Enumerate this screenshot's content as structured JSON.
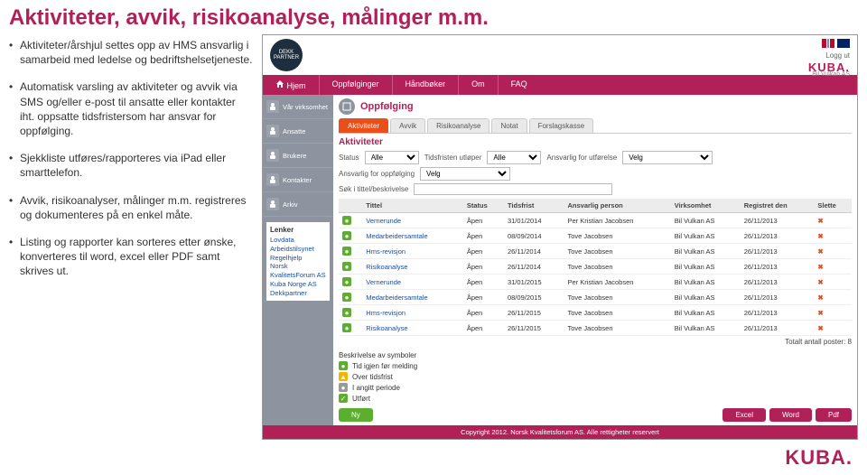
{
  "slide": {
    "title": "Aktiviteter, avvik, risikoanalyse, målinger m.m.",
    "bullets": [
      "Aktiviteter/årshjul settes opp av HMS ansvarlig i samarbeid med ledelse og bedriftshelsetjeneste.",
      "Automatisk varsling av aktiviteter og avvik via SMS og/eller e-post til ansatte eller kontakter iht. oppsatte tidsfristersom har ansvar for oppfølging.",
      "Sjekkliste utføres/rapporteres via iPad eller smarttelefon.",
      "Avvik, risikoanalyser, målinger m.m. registreres og dokumenteres på en enkel måte.",
      "Listing og rapporter kan sorteres etter ønske, konverteres til word, excel eller PDF samt skrives ut."
    ],
    "brand": "KUBA."
  },
  "app": {
    "header": {
      "badge": "DEKK PARTNER",
      "logout": "Logg ut",
      "brand": "KUBA.",
      "systemet": "systemet i skyen",
      "company": "Bil Vulkan AS"
    },
    "menu": [
      "Hjem",
      "Oppfølginger",
      "Håndbøker",
      "Om",
      "FAQ"
    ],
    "sidebar": {
      "items": [
        {
          "label": "Vår virksomhet"
        },
        {
          "label": "Ansatte"
        },
        {
          "label": "Brukere"
        },
        {
          "label": "Kontakter"
        },
        {
          "label": "Arkiv"
        }
      ],
      "links_title": "Lenker",
      "links": [
        "Lovdata",
        "Arbeidstilsynet",
        "Regelhjelp",
        "Norsk KvalitetsForum AS",
        "Kuba Norge AS",
        "Dekkpartner"
      ]
    },
    "crumb": "Oppfølging",
    "tabs": [
      {
        "label": "Aktiviteter",
        "active": true
      },
      {
        "label": "Avvik"
      },
      {
        "label": "Risikoanalyse"
      },
      {
        "label": "Notat"
      },
      {
        "label": "Forslagskasse"
      }
    ],
    "section_title": "Aktiviteter",
    "filters": {
      "status_label": "Status",
      "status_value": "Alle",
      "tidsfrist_label": "Tidsfristen utløper",
      "tidsfrist_value": "Alle",
      "ansvarlig_ut_label": "Ansvarlig for utførelse",
      "ansvarlig_ut_value": "Velg",
      "ansvarlig_opp_label": "Ansvarlig for oppfølging",
      "ansvarlig_opp_value": "Velg",
      "search_label": "Søk i tittel/beskrivelse",
      "search_placeholder": ""
    },
    "table": {
      "headers": [
        "",
        "Tittel",
        "Status",
        "Tidsfrist",
        "Ansvarlig person",
        "Virksomhet",
        "Registret den",
        "Slette"
      ],
      "rows": [
        {
          "t": "Vernerunde",
          "s": "Åpen",
          "d": "31/01/2014",
          "a": "Per Kristian Jacobsen",
          "v": "Bil Vulkan AS",
          "r": "26/11/2013"
        },
        {
          "t": "Medarbeidersamtale",
          "s": "Åpen",
          "d": "08/09/2014",
          "a": "Tove Jacobsen",
          "v": "Bil Vulkan AS",
          "r": "26/11/2013"
        },
        {
          "t": "Hms-revisjon",
          "s": "Åpen",
          "d": "26/11/2014",
          "a": "Tove Jacobsen",
          "v": "Bil Vulkan AS",
          "r": "26/11/2013"
        },
        {
          "t": "Risikoanalyse",
          "s": "Åpen",
          "d": "26/11/2014",
          "a": "Tove Jacobsen",
          "v": "Bil Vulkan AS",
          "r": "26/11/2013"
        },
        {
          "t": "Vernerunde",
          "s": "Åpen",
          "d": "31/01/2015",
          "a": "Per Kristian Jacobsen",
          "v": "Bil Vulkan AS",
          "r": "26/11/2013"
        },
        {
          "t": "Medarbeidersamtale",
          "s": "Åpen",
          "d": "08/09/2015",
          "a": "Tove Jacobsen",
          "v": "Bil Vulkan AS",
          "r": "26/11/2013"
        },
        {
          "t": "Hms-revisjon",
          "s": "Åpen",
          "d": "26/11/2015",
          "a": "Tove Jacobsen",
          "v": "Bil Vulkan AS",
          "r": "26/11/2013"
        },
        {
          "t": "Risikoanalyse",
          "s": "Åpen",
          "d": "26/11/2015",
          "a": "Tove Jacobsen",
          "v": "Bil Vulkan AS",
          "r": "26/11/2013"
        }
      ],
      "total": "Totalt antall poster: 8"
    },
    "symbols": {
      "title": "Beskrivelse av symboler",
      "items": [
        {
          "cls": "s-green",
          "txt": "Tid igjen før melding"
        },
        {
          "cls": "s-yellow",
          "txt": "Over tidsfrist"
        },
        {
          "cls": "s-gray",
          "txt": "I angitt periode"
        },
        {
          "cls": "s-check",
          "txt": "Utført"
        }
      ]
    },
    "buttons": {
      "ny": "Ny",
      "excel": "Excel",
      "word": "Word",
      "pdf": "Pdf"
    },
    "footer": "Copyright 2012. Norsk Kvalitetsforum AS. Alle rettigheter reservert"
  }
}
